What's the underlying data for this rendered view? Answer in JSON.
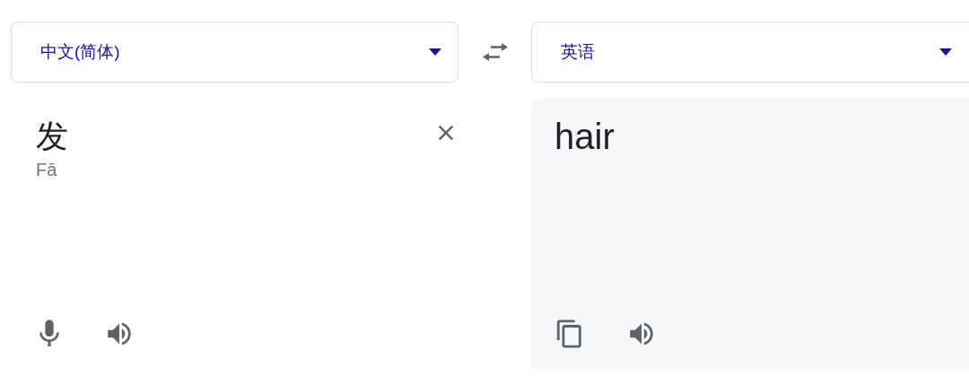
{
  "source_language": {
    "label": "中文(简体)"
  },
  "target_language": {
    "label": "英语"
  },
  "source": {
    "value": "发",
    "romanization": "Fā"
  },
  "translation": {
    "text": "hair"
  }
}
